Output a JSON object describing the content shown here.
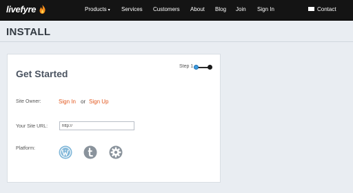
{
  "nav": {
    "logo": "livefyre",
    "items": [
      {
        "label": "Products",
        "caret": "▾"
      },
      {
        "label": "Services"
      },
      {
        "label": "Customers"
      },
      {
        "label": "About"
      },
      {
        "label": "Blog"
      },
      {
        "label": "Join"
      },
      {
        "label": "Sign In"
      }
    ],
    "contact": "Contact"
  },
  "page": {
    "title": "INSTALL"
  },
  "card": {
    "title": "Get Started",
    "step": "Step 1",
    "site_owner_label": "Site Owner:",
    "sign_in": "Sign In",
    "or": "or",
    "sign_up": "Sign Up",
    "url_label": "Your Site URL:",
    "url_value": "http://",
    "platform_label": "Platform:",
    "platforms": [
      "wordpress-icon",
      "tumblr-icon",
      "settings-icon"
    ]
  },
  "colors": {
    "nav_bg": "#141414",
    "accent_link": "#e2571e",
    "step_active": "#3d9be0",
    "platform_wp": "#7fb6d8",
    "platform_gray": "#8a939c"
  }
}
